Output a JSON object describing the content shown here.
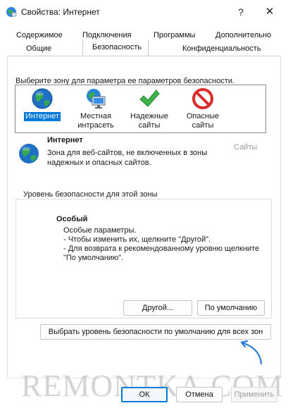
{
  "window": {
    "title": "Свойства: Интернет",
    "help_label": "?",
    "close_label": "✕"
  },
  "tabs": {
    "row1": [
      "Содержимое",
      "Подключения",
      "Программы",
      "Дополнительно"
    ],
    "row2": [
      "Общие",
      "Безопасность",
      "Конфиденциальность"
    ],
    "selected": "Безопасность"
  },
  "zones": {
    "prompt": "Выберите зону для параметра ее параметров безопасности.",
    "items": [
      {
        "label_line1": "Интернет",
        "label_line2": "",
        "icon": "globe-icon",
        "selected": true
      },
      {
        "label_line1": "Местная",
        "label_line2": "интрасеть",
        "icon": "intranet-icon",
        "selected": false
      },
      {
        "label_line1": "Надежные",
        "label_line2": "сайты",
        "icon": "checkmark-icon",
        "selected": false
      },
      {
        "label_line1": "Опасные",
        "label_line2": "сайты",
        "icon": "restricted-icon",
        "selected": false
      }
    ]
  },
  "zone_info": {
    "name": "Интернет",
    "description": "Зона для веб-сайтов, не включенных в зоны надежных и опасных сайтов.",
    "sites_button": "Сайты"
  },
  "security_level": {
    "group_title": "Уровень безопасности для этой зоны",
    "level_name": "Особый",
    "lines": [
      "Особые параметры.",
      "- Чтобы изменить их, щелкните \"Другой\".",
      "- Для возврата к рекомендованному уровню щелкните",
      "\"По умолчанию\"."
    ],
    "other_button": "Другой...",
    "default_button": "По умолчанию"
  },
  "reset_all_button": "Выбрать уровень безопасности по умолчанию для всех зон",
  "footer": {
    "ok": "ОК",
    "cancel": "Отмена",
    "apply": "Применить"
  },
  "watermark": "REMONTKA.COM",
  "colors": {
    "accent": "#0078d7",
    "disabled_text": "#9a9a9a"
  }
}
